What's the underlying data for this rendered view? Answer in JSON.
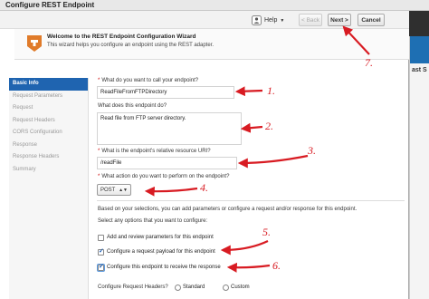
{
  "window": {
    "title": "Configure REST Endpoint"
  },
  "toolbar": {
    "help": "Help",
    "back": "< Back",
    "next": "Next >",
    "cancel": "Cancel"
  },
  "header": {
    "title": "Welcome to the REST Endpoint Configuration Wizard",
    "description": "This wizard helps you configure an endpoint using the REST adapter."
  },
  "background": {
    "right_text": "ast S"
  },
  "nav": {
    "items": [
      {
        "label": "Basic Info",
        "active": true
      },
      {
        "label": "Request Parameters",
        "active": false
      },
      {
        "label": "Request",
        "active": false
      },
      {
        "label": "Request Headers",
        "active": false
      },
      {
        "label": "CORS Configuration",
        "active": false
      },
      {
        "label": "Response",
        "active": false
      },
      {
        "label": "Response Headers",
        "active": false
      },
      {
        "label": "Summary",
        "active": false
      }
    ]
  },
  "form": {
    "required_mark": "*",
    "name_label": "What do you want to call your endpoint?",
    "name_value": "ReadFileFromFTPDirectory",
    "desc_label": "What does this endpoint do?",
    "desc_value": "Read file from FTP server directory.",
    "uri_label": "What is the endpoint's relative resource URI?",
    "uri_value": "/readFile",
    "action_label": "What action do you want to perform on the endpoint?",
    "action_value": "POST",
    "info_text": "Based on your selections, you can add parameters or configure a request and/or response for this endpoint.",
    "options_label": "Select any options that you want to configure:",
    "options": [
      {
        "label": "Add and review parameters for this endpoint",
        "checked": false
      },
      {
        "label": "Configure a request payload for this endpoint",
        "checked": true
      },
      {
        "label": "Configure this endpoint to receive the response",
        "checked": true
      }
    ],
    "request_headers_label": "Configure Request Headers?",
    "header_choices": [
      "Standard",
      "Custom"
    ]
  },
  "annotations": [
    "1.",
    "2.",
    "3.",
    "4.",
    "5.",
    "6.",
    "7."
  ],
  "colors": {
    "annotation": "#d81b22",
    "nav_active": "#1f64b0",
    "brand_orange": "#e07b2a"
  }
}
